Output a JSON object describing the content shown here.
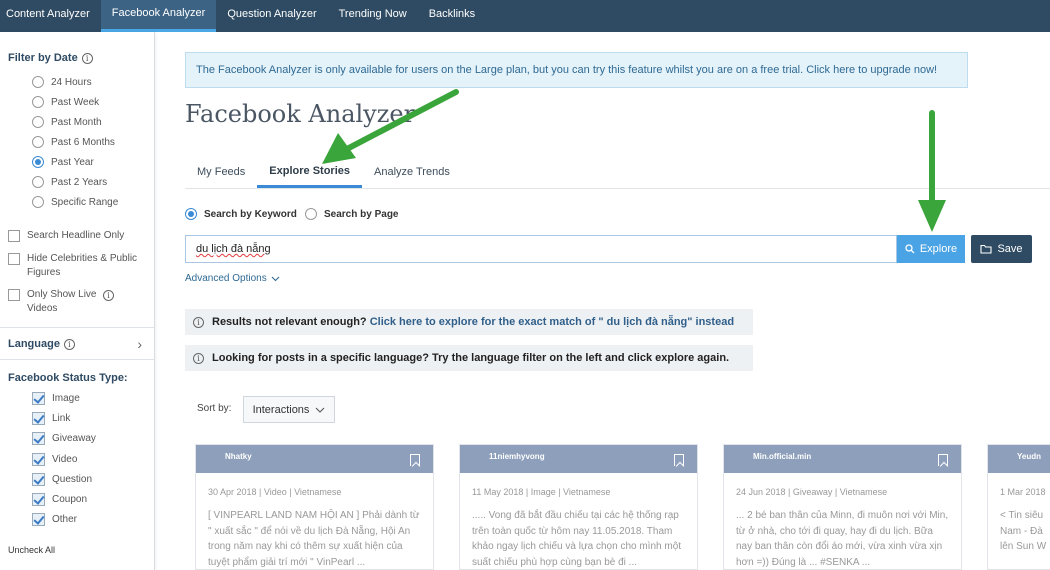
{
  "topnav": {
    "items": [
      "Content Analyzer",
      "Facebook Analyzer",
      "Question Analyzer",
      "Trending Now",
      "Backlinks"
    ],
    "active_index": 1
  },
  "sidebar": {
    "filter_date": {
      "heading": "Filter by Date",
      "options": [
        "24 Hours",
        "Past Week",
        "Past Month",
        "Past 6 Months",
        "Past Year",
        "Past 2 Years",
        "Specific Range"
      ],
      "selected": "Past Year"
    },
    "checkboxes": [
      "Search Headline Only",
      "Hide Celebrities & Public Figures",
      "Only Show Live Videos"
    ],
    "language": {
      "heading": "Language"
    },
    "status_type": {
      "heading": "Facebook Status Type:",
      "options": [
        "Image",
        "Link",
        "Giveaway",
        "Video",
        "Question",
        "Coupon",
        "Other"
      ]
    },
    "uncheck_all": "Uncheck All"
  },
  "banner": {
    "text": "The Facebook Analyzer is only available for users on the Large plan, but you can try this feature whilst you are on a free trial. Click here to upgrade now!"
  },
  "page_title": "Facebook Analyzer",
  "tabs": [
    "My Feeds",
    "Explore Stories",
    "Analyze Trends"
  ],
  "active_tab": "Explore Stories",
  "search": {
    "mode_keyword": "Search by Keyword",
    "mode_page": "Search by Page",
    "value": "du lịch đà nẵng",
    "explore_label": "Explore",
    "save_label": "Save",
    "advanced_label": "Advanced Options"
  },
  "notices": {
    "relevance_prefix": "Results not relevant enough?",
    "relevance_link": "Click here to explore for the exact match of \" du lịch đà nẵng\" instead",
    "language": "Looking for posts in a specific language? Try the language filter on the left and click explore again."
  },
  "sort": {
    "label": "Sort by:",
    "value": "Interactions"
  },
  "cards": [
    {
      "page": "Nhatky",
      "meta": "30 Apr 2018 | Video | Vietnamese",
      "text": "[ VINPEARL LAND NAM HỘI AN ] Phải dành từ \" xuất sắc \" để nói về du lịch Đà Nẵng, Hội An trong năm nay khi có thêm sự xuất hiện của tuyệt phẩm giải trí mới \" VinPearl ..."
    },
    {
      "page": "11niemhyvong",
      "meta": "11 May 2018 | Image | Vietnamese",
      "text": "..... Vong đã bắt đầu chiếu tại các hệ thống rạp trên toàn quốc từ hôm nay 11.05.2018. Tham khảo ngay lịch chiếu và lựa chọn cho mình một suất chiếu phù hợp cùng bạn bè đi ..."
    },
    {
      "page": "Min.official.min",
      "meta": "24 Jun 2018 | Giveaway | Vietnamese",
      "text": "... 2 bé ban thân của Minn, đi muôn nơi với Min, từ ở nhà, cho tới đi quay, hay đi du lịch. Bữa nay ban thân còn đổi áo mới, vừa xinh vừa xịn hơn =)) Đúng là ... #SENKA ..."
    },
    {
      "page": "Yeudn",
      "meta": "1 Mar 2018",
      "text": "< Tin siêu Nam - Đà lên Sun W"
    }
  ]
}
